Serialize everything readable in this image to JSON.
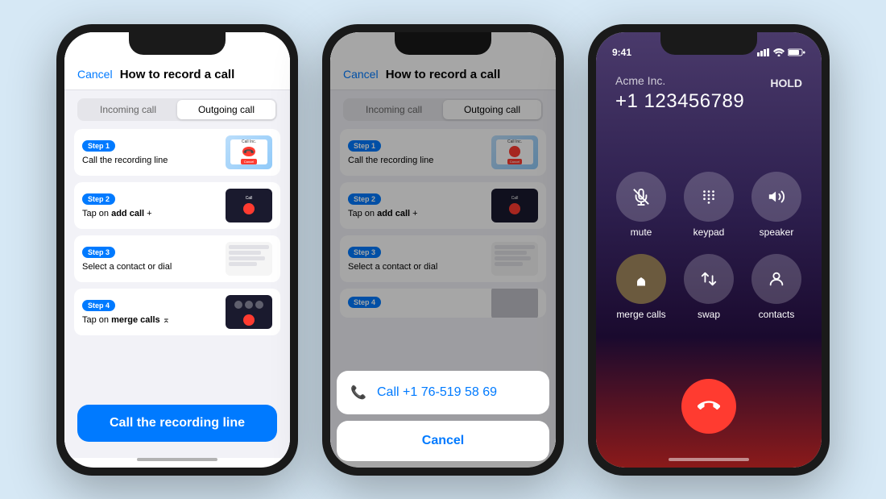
{
  "bg_color": "#d6e8f5",
  "phone1": {
    "header": {
      "cancel": "Cancel",
      "title": "How to record a call"
    },
    "tabs": [
      {
        "label": "Incoming call",
        "active": false
      },
      {
        "label": "Outgoing call",
        "active": true
      }
    ],
    "steps": [
      {
        "badge": "Step 1",
        "text": "Call the recording line"
      },
      {
        "badge": "Step 2",
        "text": "Tap on <b>add call</b> +"
      },
      {
        "badge": "Step 3",
        "text": "Select a contact or dial"
      },
      {
        "badge": "Step 4",
        "text": "Tap on <b>merge calls</b> ⌅"
      }
    ],
    "cta": "Call the recording line"
  },
  "phone2": {
    "header": {
      "cancel": "Cancel",
      "title": "How to record a call"
    },
    "tabs": [
      {
        "label": "Incoming call",
        "active": false
      },
      {
        "label": "Outgoing call",
        "active": true
      }
    ],
    "steps": [
      {
        "badge": "Step 1",
        "text": "Call the recording line"
      },
      {
        "badge": "Step 2",
        "text": "Tap on <b>add call</b> +"
      },
      {
        "badge": "Step 3",
        "text": "Select a contact or dial"
      },
      {
        "badge": "Step 4",
        "text": ""
      }
    ],
    "action_sheet": {
      "call_action": "Call +1 76-519 58 69",
      "cancel": "Cancel"
    }
  },
  "phone3": {
    "status_bar": {
      "time": "9:41",
      "signal": "▲▲▲",
      "wifi": "WiFi",
      "battery": "🔋"
    },
    "company": "Acme Inc.",
    "hold": "HOLD",
    "number": "+1 123456789",
    "controls": [
      {
        "icon": "🔇",
        "label": "mute",
        "highlighted": false
      },
      {
        "icon": "⌨",
        "label": "keypad",
        "highlighted": false
      },
      {
        "icon": "🔊",
        "label": "speaker",
        "highlighted": false
      },
      {
        "icon": "⌅",
        "label": "merge calls",
        "highlighted": true
      },
      {
        "icon": "⇅",
        "label": "swap",
        "highlighted": false
      },
      {
        "icon": "👤",
        "label": "contacts",
        "highlighted": false
      }
    ],
    "end_call": "📞"
  }
}
